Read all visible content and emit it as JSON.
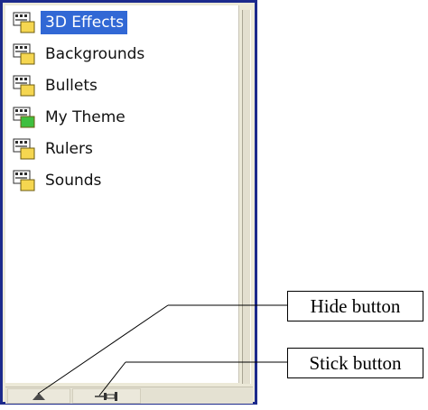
{
  "list": {
    "items": [
      {
        "label": "3D Effects",
        "selected": true,
        "icon": "theme-folder-yellow-icon"
      },
      {
        "label": "Backgrounds",
        "selected": false,
        "icon": "theme-folder-yellow-icon"
      },
      {
        "label": "Bullets",
        "selected": false,
        "icon": "theme-folder-yellow-icon"
      },
      {
        "label": "My Theme",
        "selected": false,
        "icon": "theme-folder-green-icon"
      },
      {
        "label": "Rulers",
        "selected": false,
        "icon": "theme-folder-yellow-icon"
      },
      {
        "label": "Sounds",
        "selected": false,
        "icon": "theme-folder-yellow-icon"
      }
    ]
  },
  "toolbar": {
    "hide_icon": "triangle-up-icon",
    "stick_icon": "pushpin-icon"
  },
  "callouts": {
    "hide": "Hide button",
    "stick": "Stick button"
  },
  "colors": {
    "frame": "#1c2a8c",
    "selection": "#3168d5",
    "icon_yellow": "#f5d650",
    "icon_green": "#3fbf3f"
  }
}
